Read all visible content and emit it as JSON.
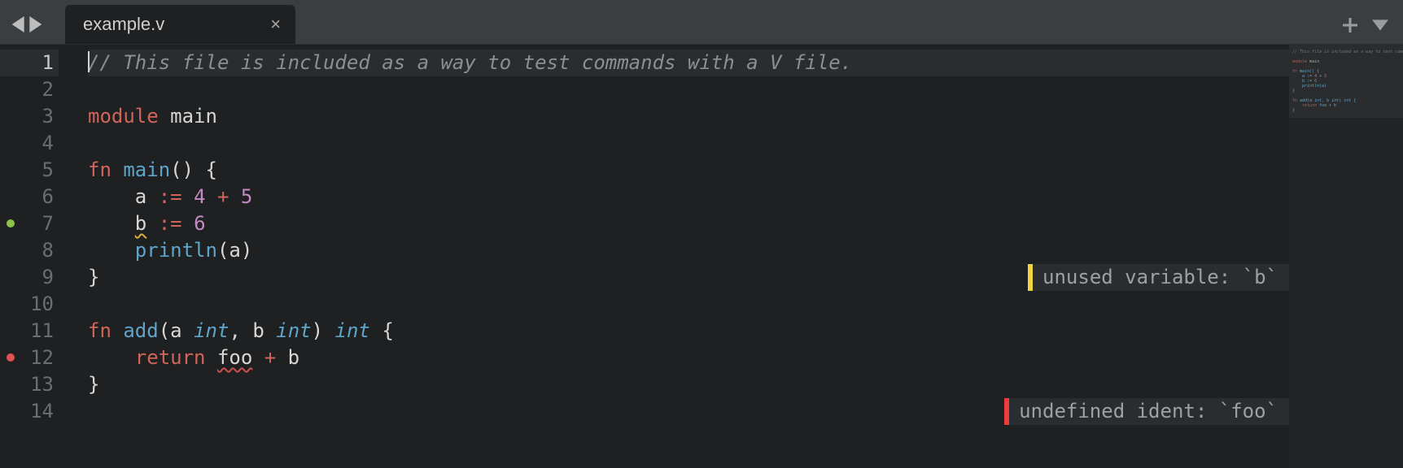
{
  "tab": {
    "filename": "example.v"
  },
  "line_count": 14,
  "current_line": 1,
  "markers": [
    {
      "line": 7,
      "color": "#8bc34a"
    },
    {
      "line": 12,
      "color": "#e05252"
    }
  ],
  "diagnostics": [
    {
      "line": 7,
      "severity": "warning",
      "bar_color": "#f0d443",
      "message": "unused variable: `b`"
    },
    {
      "line": 12,
      "severity": "error",
      "bar_color": "#ef3b3b",
      "message": "undefined ident: `foo`"
    }
  ],
  "code": {
    "l1_comment": "// This file is included as a way to test commands with a V file.",
    "l3_kw": "module",
    "l3_name": "main",
    "l5_kw": "fn",
    "l5_name": "main",
    "l5_rest": "() {",
    "l6_a": "a",
    "l6_op1": ":=",
    "l6_n1": "4",
    "l6_plus": "+",
    "l6_n2": "5",
    "l7_b": "b",
    "l7_op": ":=",
    "l7_n": "6",
    "l8_fn": "println",
    "l8_arg": "a",
    "l9_brace": "}",
    "l11_kw": "fn",
    "l11_name": "add",
    "l11_p_a": "a",
    "l11_t1": "int",
    "l11_comma": ",",
    "l11_p_b": "b",
    "l11_t2": "int",
    "l11_ret": "int",
    "l11_brace": "{",
    "l12_kw": "return",
    "l12_foo": "foo",
    "l12_plus": "+",
    "l12_b": "b",
    "l13_brace": "}"
  }
}
